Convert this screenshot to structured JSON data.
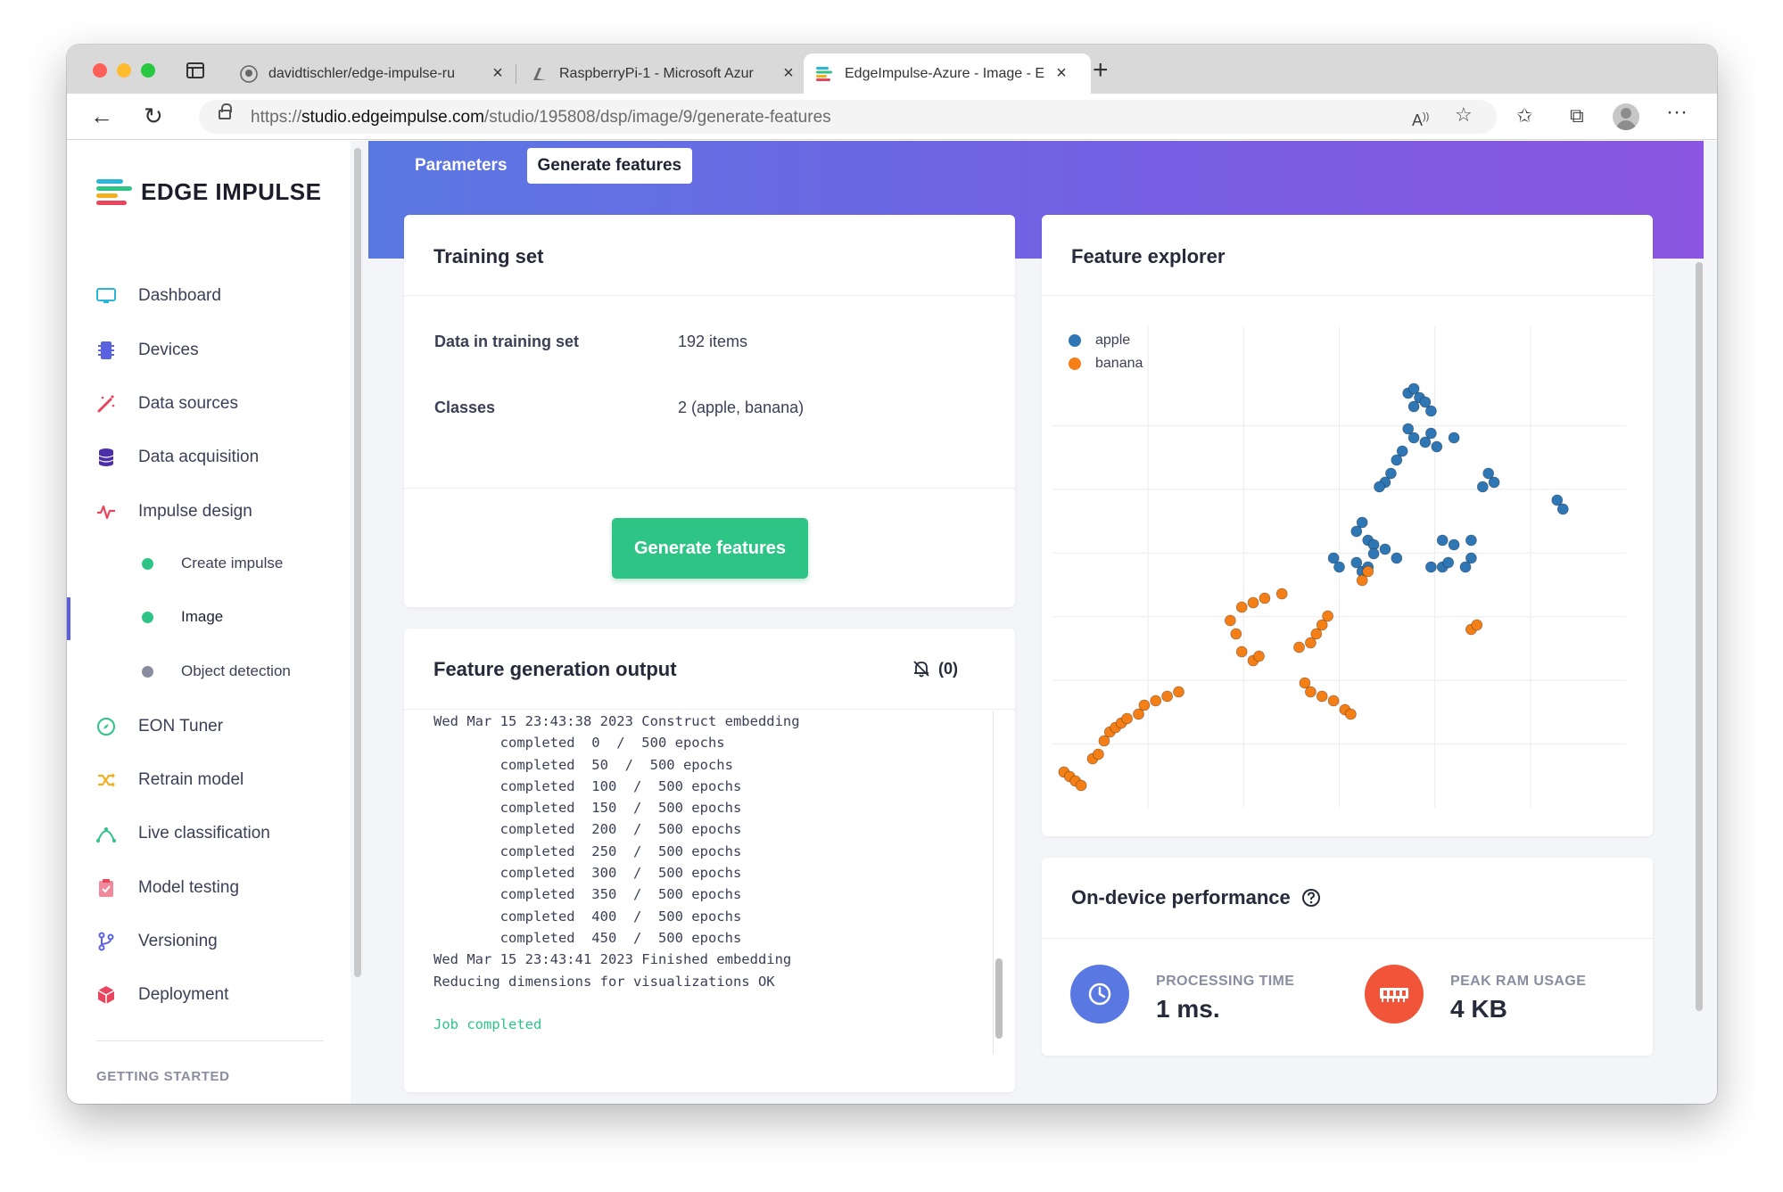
{
  "browser": {
    "tabs": [
      {
        "label": "davidtischler/edge-impulse-ru",
        "icon": "github-icon"
      },
      {
        "label": "RaspberryPi-1 - Microsoft Azur",
        "icon": "azure-icon"
      },
      {
        "label": "EdgeImpulse-Azure - Image - E",
        "icon": "edge-impulse-icon"
      }
    ],
    "url_scheme": "https://",
    "url_host": "studio.edgeimpulse.com",
    "url_path": "/studio/195808/dsp/image/9/generate-features"
  },
  "sidebar": {
    "brand": "EDGE IMPULSE",
    "items": [
      {
        "label": "Dashboard",
        "icon": "monitor-icon",
        "color": "#2bb5d6"
      },
      {
        "label": "Devices",
        "icon": "chip-icon",
        "color": "#5a62e0"
      },
      {
        "label": "Data sources",
        "icon": "magic-wand-icon",
        "color": "#e8455e"
      },
      {
        "label": "Data acquisition",
        "icon": "database-icon",
        "color": "#4a2fa8"
      },
      {
        "label": "Impulse design",
        "icon": "pulse-icon",
        "color": "#e8455e"
      }
    ],
    "subitems": [
      {
        "label": "Create impulse",
        "status_color": "#2dc486"
      },
      {
        "label": "Image",
        "status_color": "#2dc486"
      },
      {
        "label": "Object detection",
        "status_color": "#8a8da0"
      }
    ],
    "items2": [
      {
        "label": "EON Tuner",
        "icon": "compass-icon",
        "color": "#2dc486"
      },
      {
        "label": "Retrain model",
        "icon": "shuffle-icon",
        "color": "#f2b01e"
      },
      {
        "label": "Live classification",
        "icon": "curve-icon",
        "color": "#2dc486"
      },
      {
        "label": "Model testing",
        "icon": "clipboard-check-icon",
        "color": "#f08a9a"
      },
      {
        "label": "Versioning",
        "icon": "git-branch-icon",
        "color": "#5a62e0"
      },
      {
        "label": "Deployment",
        "icon": "box-icon",
        "color": "#e8455e"
      }
    ],
    "getting_started": "GETTING STARTED"
  },
  "tabs": {
    "parameters": "Parameters",
    "generate_features": "Generate features"
  },
  "training_set": {
    "title": "Training set",
    "data_label": "Data in training set",
    "data_value": "192 items",
    "classes_label": "Classes",
    "classes_value": "2 (apple, banana)",
    "button": "Generate features"
  },
  "output": {
    "title": "Feature generation output",
    "notifications": "(0)",
    "lines": [
      "Wed Mar 15 23:43:38 2023 Construct embedding",
      "        completed  0  /  500 epochs",
      "        completed  50  /  500 epochs",
      "        completed  100  /  500 epochs",
      "        completed  150  /  500 epochs",
      "        completed  200  /  500 epochs",
      "        completed  250  /  500 epochs",
      "        completed  300  /  500 epochs",
      "        completed  350  /  500 epochs",
      "        completed  400  /  500 epochs",
      "        completed  450  /  500 epochs",
      "Wed Mar 15 23:43:41 2023 Finished embedding",
      "Reducing dimensions for visualizations OK",
      "",
      "Job completed"
    ]
  },
  "explorer": {
    "title": "Feature explorer"
  },
  "performance": {
    "title": "On-device performance",
    "processing_label": "PROCESSING TIME",
    "processing_value": "1 ms.",
    "ram_label": "PEAK RAM USAGE",
    "ram_value": "4 KB"
  },
  "chart_data": {
    "type": "scatter",
    "title": "",
    "xlabel": "",
    "ylabel": "",
    "xlim": [
      0,
      10
    ],
    "ylim": [
      0,
      10
    ],
    "grid": true,
    "legend": "top-left",
    "series": [
      {
        "name": "apple",
        "color": "#2f77b4",
        "points": [
          [
            6.2,
            9.3
          ],
          [
            6.3,
            9.4
          ],
          [
            6.4,
            9.2
          ],
          [
            6.3,
            9.0
          ],
          [
            6.5,
            9.1
          ],
          [
            6.6,
            8.9
          ],
          [
            6.2,
            8.5
          ],
          [
            6.3,
            8.3
          ],
          [
            6.5,
            8.2
          ],
          [
            6.7,
            8.1
          ],
          [
            6.1,
            8.0
          ],
          [
            6.0,
            7.8
          ],
          [
            5.9,
            7.5
          ],
          [
            5.8,
            7.3
          ],
          [
            5.7,
            7.2
          ],
          [
            6.6,
            8.4
          ],
          [
            7.0,
            8.3
          ],
          [
            7.6,
            7.5
          ],
          [
            7.7,
            7.3
          ],
          [
            7.5,
            7.2
          ],
          [
            8.8,
            6.9
          ],
          [
            8.9,
            6.7
          ],
          [
            5.4,
            6.4
          ],
          [
            5.3,
            6.2
          ],
          [
            5.5,
            6.0
          ],
          [
            5.6,
            5.9
          ],
          [
            5.8,
            5.8
          ],
          [
            6.0,
            5.6
          ],
          [
            5.6,
            5.7
          ],
          [
            6.8,
            6.0
          ],
          [
            7.0,
            5.9
          ],
          [
            7.3,
            6.0
          ],
          [
            4.9,
            5.6
          ],
          [
            5.0,
            5.4
          ],
          [
            5.3,
            5.5
          ],
          [
            5.4,
            5.3
          ],
          [
            5.5,
            5.4
          ],
          [
            6.6,
            5.4
          ],
          [
            6.8,
            5.4
          ],
          [
            6.9,
            5.5
          ],
          [
            7.3,
            5.6
          ],
          [
            7.2,
            5.4
          ]
        ],
        "size": 10
      },
      {
        "name": "banana",
        "color": "#f57f17",
        "points": [
          [
            0.2,
            0.8
          ],
          [
            0.3,
            0.7
          ],
          [
            0.4,
            0.6
          ],
          [
            0.5,
            0.5
          ],
          [
            0.7,
            1.1
          ],
          [
            0.8,
            1.2
          ],
          [
            0.9,
            1.5
          ],
          [
            1.0,
            1.7
          ],
          [
            1.1,
            1.8
          ],
          [
            1.2,
            1.9
          ],
          [
            1.3,
            2.0
          ],
          [
            1.5,
            2.1
          ],
          [
            1.6,
            2.3
          ],
          [
            1.8,
            2.4
          ],
          [
            2.0,
            2.5
          ],
          [
            2.2,
            2.6
          ],
          [
            4.4,
            2.8
          ],
          [
            4.5,
            2.6
          ],
          [
            4.7,
            2.5
          ],
          [
            4.9,
            2.4
          ],
          [
            5.1,
            2.2
          ],
          [
            5.2,
            2.1
          ],
          [
            3.3,
            3.5
          ],
          [
            3.5,
            3.3
          ],
          [
            3.6,
            3.4
          ],
          [
            3.2,
            3.9
          ],
          [
            3.1,
            4.2
          ],
          [
            3.3,
            4.5
          ],
          [
            3.5,
            4.6
          ],
          [
            3.7,
            4.7
          ],
          [
            4.0,
            4.8
          ],
          [
            4.3,
            3.6
          ],
          [
            4.5,
            3.7
          ],
          [
            4.6,
            3.9
          ],
          [
            4.7,
            4.1
          ],
          [
            4.8,
            4.3
          ],
          [
            5.4,
            5.1
          ],
          [
            5.5,
            5.3
          ],
          [
            7.3,
            4.0
          ],
          [
            7.4,
            4.1
          ]
        ],
        "size": 10
      }
    ]
  }
}
